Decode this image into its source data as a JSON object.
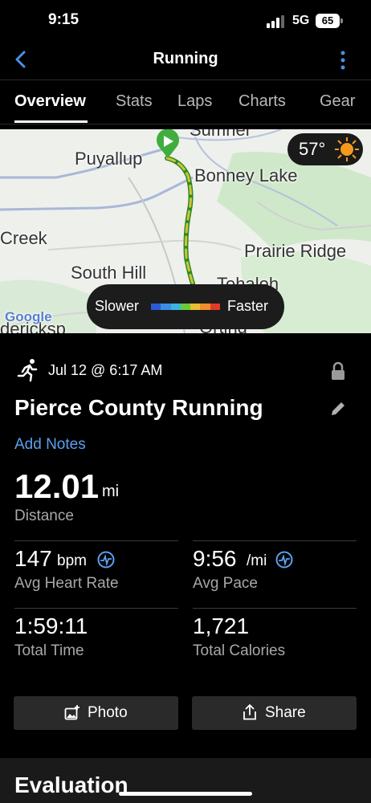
{
  "status_bar": {
    "time": "9:15",
    "network": "5G",
    "battery": "65"
  },
  "header": {
    "title": "Running"
  },
  "tabs": [
    {
      "label": "Overview",
      "active": true
    },
    {
      "label": "Stats"
    },
    {
      "label": "Laps"
    },
    {
      "label": "Charts"
    },
    {
      "label": "Gear"
    }
  ],
  "map": {
    "labels": [
      "Puyallup",
      "Bonney Lake",
      "Creek",
      "Prairie Ridge",
      "South Hill",
      "Tehaleh",
      "Orting",
      "dericksp",
      "Sumner"
    ],
    "weather": {
      "temperature": "57°",
      "icon": "sun-icon"
    },
    "legend": {
      "slower": "Slower",
      "faster": "Faster"
    },
    "attribution": "Google",
    "route_colors": [
      "#2a5bd7",
      "#3d8ee8",
      "#38b6e0",
      "#6dc93c",
      "#e8c032",
      "#f08c2a",
      "#e03a2a"
    ]
  },
  "activity": {
    "date": "Jul 12 @ 6:17 AM",
    "name": "Pierce County Running",
    "add_notes": "Add Notes",
    "distance": {
      "value": "12.01",
      "unit": "mi",
      "label": "Distance"
    },
    "heart_rate": {
      "value": "147",
      "unit": "bpm",
      "label": "Avg Heart Rate"
    },
    "pace": {
      "value": "9:56",
      "unit": "/mi",
      "label": "Avg Pace"
    },
    "time": {
      "value": "1:59:11",
      "label": "Total Time"
    },
    "calories": {
      "value": "1,721",
      "label": "Total Calories"
    }
  },
  "buttons": {
    "photo": "Photo",
    "share": "Share"
  },
  "evaluation": {
    "title": "Evaluation"
  },
  "colors": {
    "accent": "#5aa0f0",
    "map_land": "#eef0ec",
    "map_green": "#cfe8c9"
  }
}
